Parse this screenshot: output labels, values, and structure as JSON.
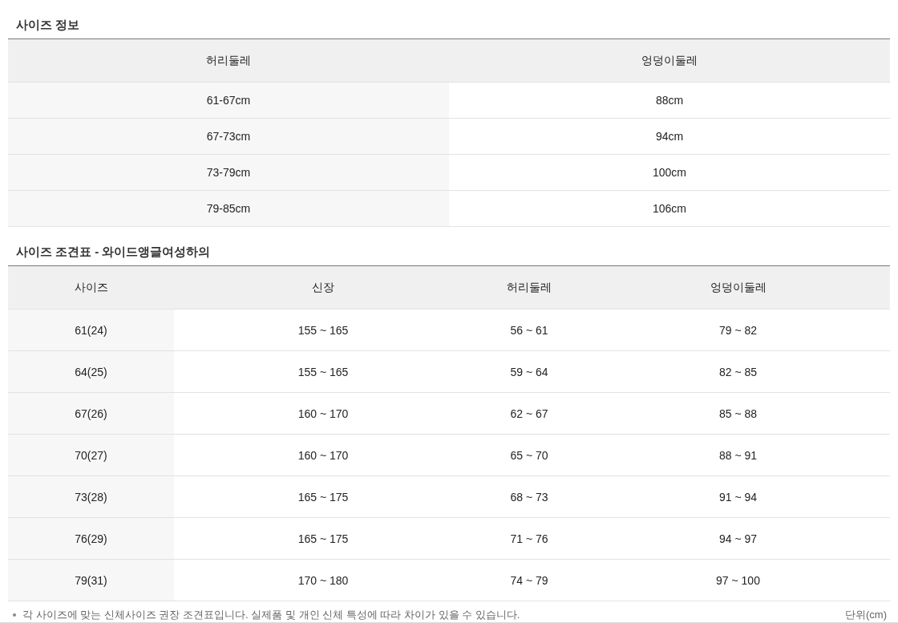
{
  "size_info": {
    "title": "사이즈 정보",
    "columns": [
      "허리둘레",
      "엉덩이둘레"
    ],
    "rows": [
      [
        "61-67cm",
        "88cm"
      ],
      [
        "67-73cm",
        "94cm"
      ],
      [
        "73-79cm",
        "100cm"
      ],
      [
        "79-85cm",
        "106cm"
      ]
    ]
  },
  "size_chart": {
    "title": "사이즈 조견표 - 와이드앵글여성하의",
    "columns": [
      "사이즈",
      "신장",
      "허리둘레",
      "엉덩이둘레"
    ],
    "rows": [
      [
        "61(24)",
        "155 ~ 165",
        "56 ~ 61",
        "79 ~ 82"
      ],
      [
        "64(25)",
        "155 ~ 165",
        "59 ~ 64",
        "82 ~ 85"
      ],
      [
        "67(26)",
        "160 ~ 170",
        "62 ~ 67",
        "85 ~ 88"
      ],
      [
        "70(27)",
        "160 ~ 170",
        "65 ~ 70",
        "88 ~ 91"
      ],
      [
        "73(28)",
        "165 ~ 175",
        "68 ~ 73",
        "91 ~ 94"
      ],
      [
        "76(29)",
        "165 ~ 175",
        "71 ~ 76",
        "94 ~ 97"
      ],
      [
        "79(31)",
        "170 ~ 180",
        "74 ~ 79",
        "97 ~ 100"
      ]
    ]
  },
  "footnote": {
    "text": "각 사이즈에 맞는 신체사이즈 권장 조견표입니다. 실제품 및 개인 신체 특성에 따라 차이가 있을 수 있습니다.",
    "unit": "단위(cm)"
  }
}
